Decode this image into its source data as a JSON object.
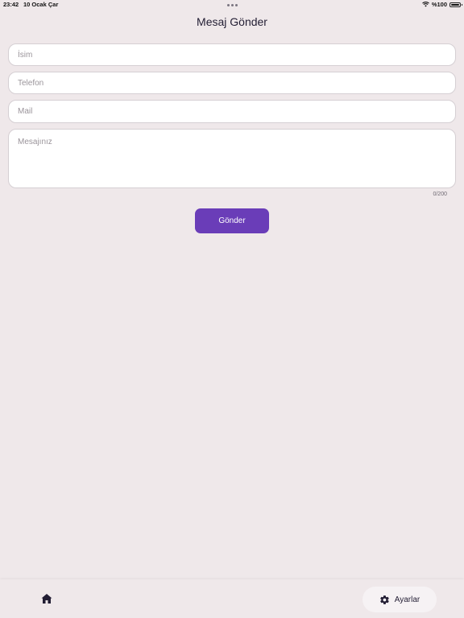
{
  "status_bar": {
    "time": "23:42",
    "date": "10 Ocak Çar",
    "battery": "%100",
    "wifi_icon": "wifi-icon",
    "battery_icon": "battery-icon"
  },
  "page": {
    "title": "Mesaj Gönder"
  },
  "form": {
    "name_placeholder": "İsim",
    "phone_placeholder": "Telefon",
    "mail_placeholder": "Mail",
    "message_placeholder": "Mesajınız",
    "counter": "0/200",
    "submit_label": "Gönder"
  },
  "bottom_nav": {
    "home_icon": "home-icon",
    "settings_icon": "gear-icon",
    "settings_label": "Ayarlar"
  },
  "colors": {
    "background": "#efe8ea",
    "accent": "#6a3db8",
    "field_background": "#ffffff"
  }
}
